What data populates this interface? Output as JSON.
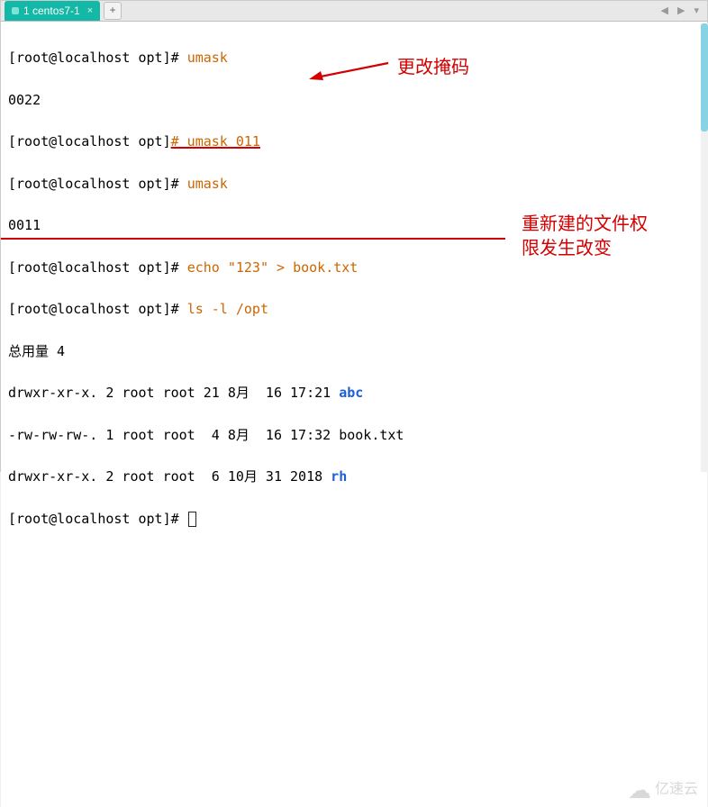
{
  "tab": {
    "label": "1 centos7-1",
    "close_glyph": "×"
  },
  "newtab_glyph": "+",
  "nav": {
    "left": "◀",
    "right": "▶",
    "menu": "▾"
  },
  "lines": {
    "l1_prompt": "[root@localhost opt]# ",
    "l1_cmd": "umask",
    "l2": "0022",
    "l3_prompt": "[root@localhost opt]",
    "l3_cmd": "# umask 011",
    "l4_prompt": "[root@localhost opt]# ",
    "l4_cmd": "umask",
    "l5": "0011",
    "l6_prompt": "[root@localhost opt]# ",
    "l6_cmd": "echo \"123\" > book.txt",
    "l7_prompt": "[root@localhost opt]# ",
    "l7_cmd": "ls -l /opt",
    "l8": "总用量 4",
    "l9_a": "drwxr-xr-x. 2 root root 21 8月  16 17:21 ",
    "l9_b": "abc",
    "l10": "-rw-rw-rw-. 1 root root  4 8月  16 17:32 book.txt",
    "l11_a": "drwxr-xr-x. 2 root root  6 10月 31 2018 ",
    "l11_b": "rh",
    "l12_prompt": "[root@localhost opt]# "
  },
  "annotations": {
    "top": "更改掩码",
    "right": "重新建的文件权\n限发生改变"
  },
  "watermark": "亿速云"
}
